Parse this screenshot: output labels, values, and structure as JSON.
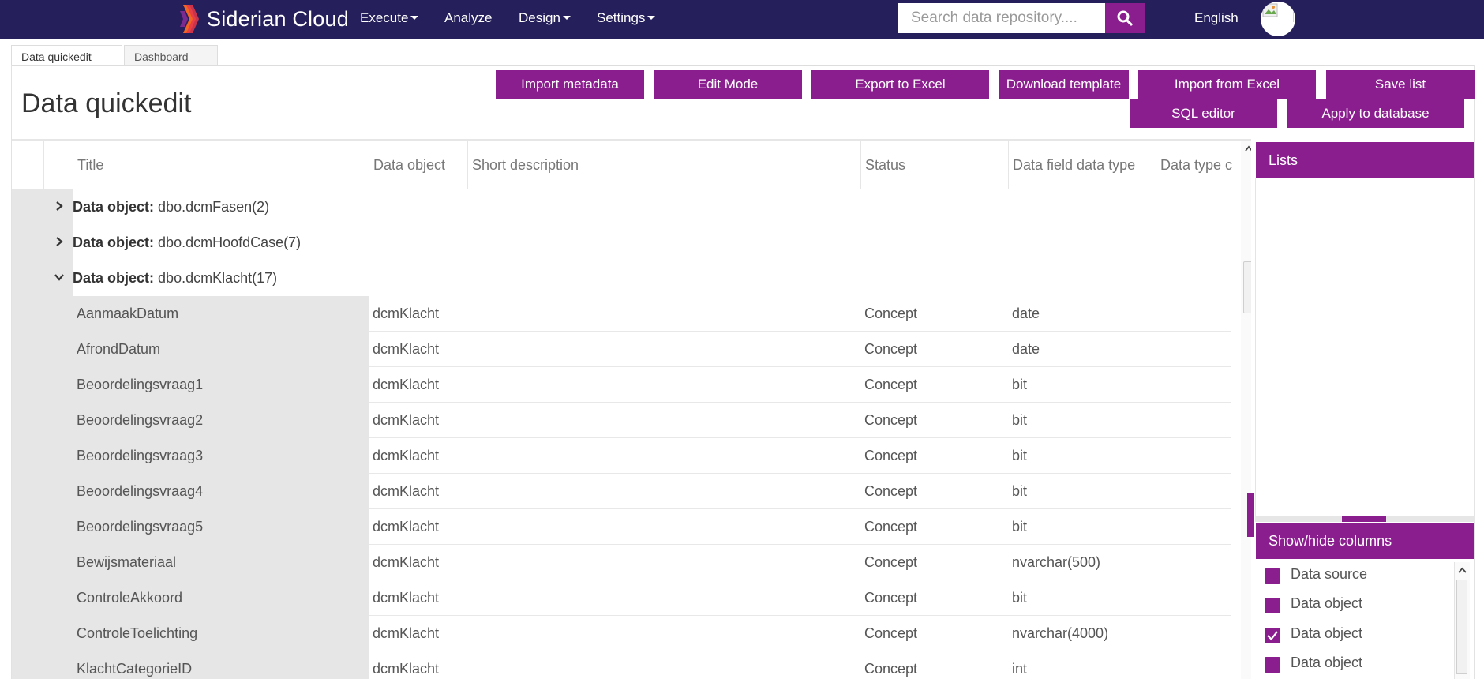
{
  "navbar": {
    "brand": "Siderian Cloud",
    "menu": [
      {
        "label": "Execute",
        "dropdown": true
      },
      {
        "label": "Analyze",
        "dropdown": false
      },
      {
        "label": "Design",
        "dropdown": true
      },
      {
        "label": "Settings",
        "dropdown": true
      }
    ],
    "search_placeholder": "Search data repository....",
    "language": "English",
    "colors": {
      "bar": "#25205b",
      "accent": "#8b1e8f"
    }
  },
  "tabs": [
    {
      "label": "Data quickedit",
      "active": true
    },
    {
      "label": "Dashboard",
      "active": false
    }
  ],
  "page": {
    "title": "Data quickedit",
    "buttons": {
      "import_metadata": "Import metadata",
      "edit_mode": "Edit Mode",
      "export_excel": "Export to Excel",
      "download_template": "Download template",
      "import_excel": "Import from Excel",
      "save_list": "Save list",
      "sql_editor": "SQL editor",
      "apply_db": "Apply to database"
    }
  },
  "grid": {
    "columns": [
      "Title",
      "Data object",
      "Short description",
      "Status",
      "Data field data type",
      "Data type c"
    ],
    "group_prefix": "Data object:",
    "groups": [
      {
        "name": "dbo.dcmFasen(2)",
        "expanded": false
      },
      {
        "name": "dbo.dcmHoofdCase(7)",
        "expanded": false
      },
      {
        "name": "dbo.dcmKlacht(17)",
        "expanded": true
      }
    ],
    "rows": [
      {
        "title": "AanmaakDatum",
        "data_object": "dcmKlacht",
        "short_description": "",
        "status": "Concept",
        "data_type": "date"
      },
      {
        "title": "AfrondDatum",
        "data_object": "dcmKlacht",
        "short_description": "",
        "status": "Concept",
        "data_type": "date"
      },
      {
        "title": "Beoordelingsvraag1",
        "data_object": "dcmKlacht",
        "short_description": "",
        "status": "Concept",
        "data_type": "bit"
      },
      {
        "title": "Beoordelingsvraag2",
        "data_object": "dcmKlacht",
        "short_description": "",
        "status": "Concept",
        "data_type": "bit"
      },
      {
        "title": "Beoordelingsvraag3",
        "data_object": "dcmKlacht",
        "short_description": "",
        "status": "Concept",
        "data_type": "bit"
      },
      {
        "title": "Beoordelingsvraag4",
        "data_object": "dcmKlacht",
        "short_description": "",
        "status": "Concept",
        "data_type": "bit"
      },
      {
        "title": "Beoordelingsvraag5",
        "data_object": "dcmKlacht",
        "short_description": "",
        "status": "Concept",
        "data_type": "bit"
      },
      {
        "title": "Bewijsmateriaal",
        "data_object": "dcmKlacht",
        "short_description": "",
        "status": "Concept",
        "data_type": "nvarchar(500)"
      },
      {
        "title": "ControleAkkoord",
        "data_object": "dcmKlacht",
        "short_description": "",
        "status": "Concept",
        "data_type": "bit"
      },
      {
        "title": "ControleToelichting",
        "data_object": "dcmKlacht",
        "short_description": "",
        "status": "Concept",
        "data_type": "nvarchar(4000)"
      },
      {
        "title": "KlachtCategorieID",
        "data_object": "dcmKlacht",
        "short_description": "",
        "status": "Concept",
        "data_type": "int"
      }
    ]
  },
  "lists_panel": {
    "title": "Lists"
  },
  "columns_panel": {
    "title": "Show/hide columns",
    "items": [
      {
        "label": "Data source",
        "checked": false
      },
      {
        "label": "Data object",
        "checked": false
      },
      {
        "label": "Data object",
        "checked": true
      },
      {
        "label": "Data object",
        "checked": false
      }
    ]
  }
}
